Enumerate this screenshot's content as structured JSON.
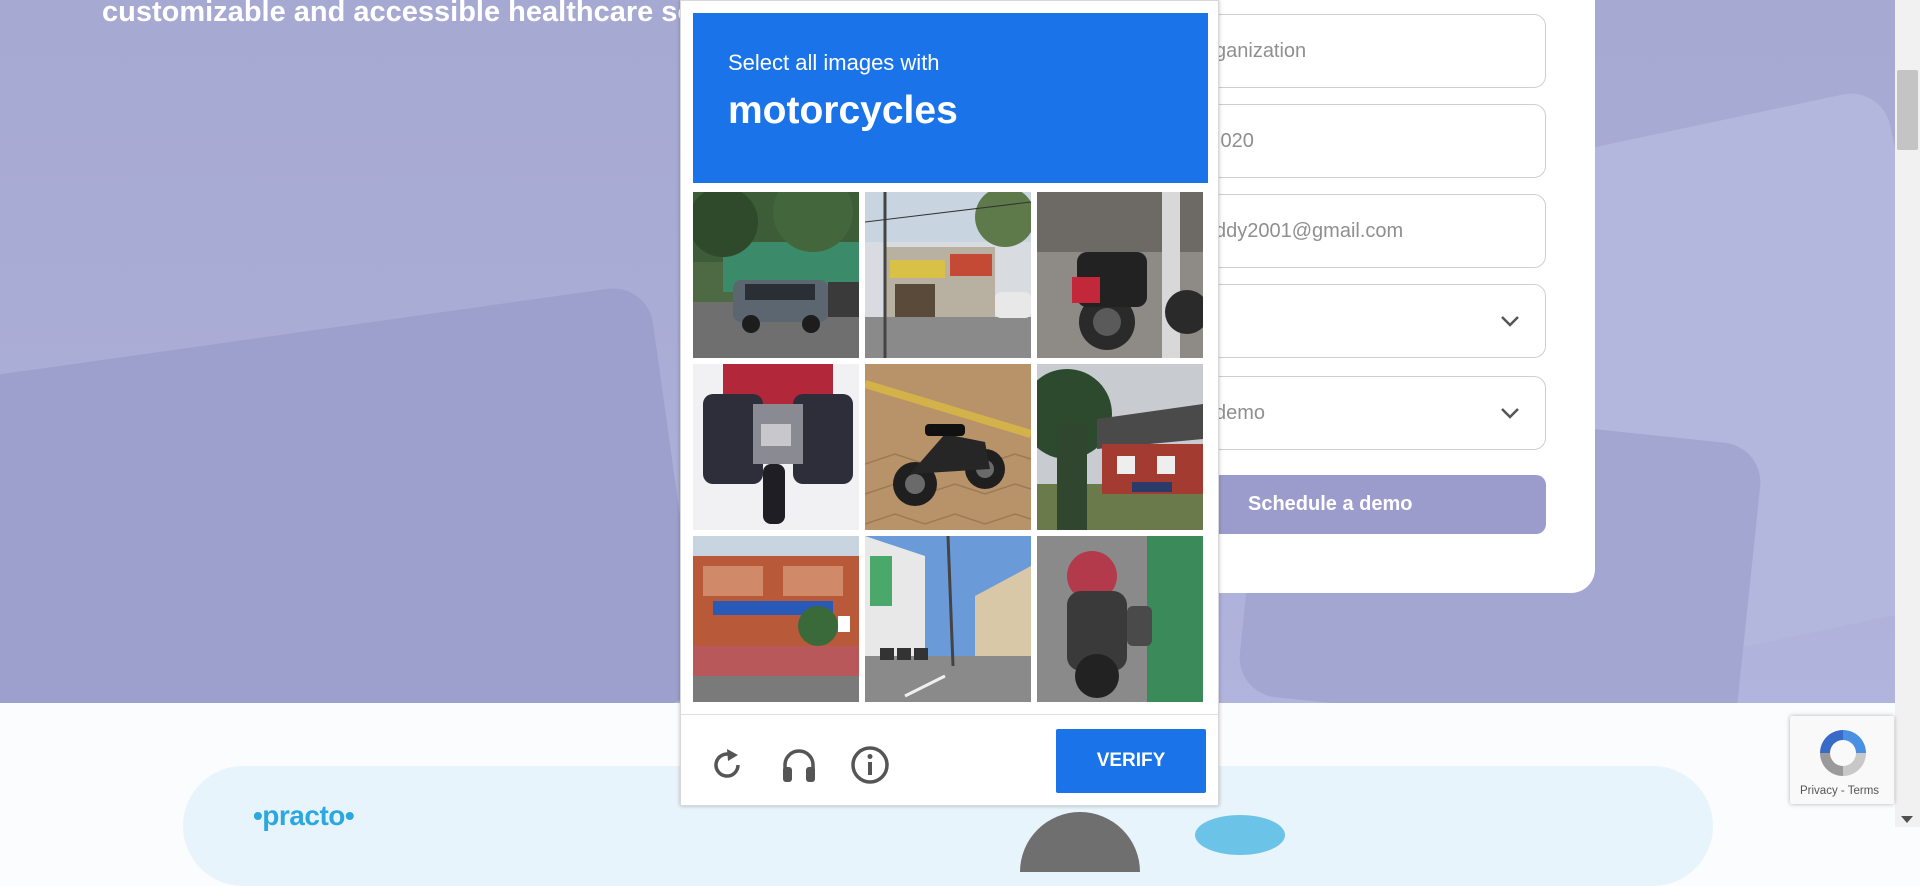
{
  "hero": {
    "text": "customizable and accessible healthcare solu"
  },
  "form": {
    "organization_value": "ganization",
    "phone_value": ".020",
    "email_value": "ddy2001@gmail.com",
    "select1_value": "",
    "select2_value": "demo",
    "schedule_label": "Schedule a demo"
  },
  "captcha": {
    "instruction_line1": "Select all images with",
    "instruction_target": "motorcycles",
    "accent_color": "#1a73e8",
    "tiles": [
      {
        "content": "car parked under trees"
      },
      {
        "content": "street storefront"
      },
      {
        "content": "motorcycle in garage"
      },
      {
        "content": "motorcycle rear close-up"
      },
      {
        "content": "motorcycle on paving"
      },
      {
        "content": "red house with tree"
      },
      {
        "content": "street with buildings"
      },
      {
        "content": "street with parked scooters"
      },
      {
        "content": "blurred scooter"
      }
    ],
    "reload_icon": "reload-icon",
    "audio_icon": "headphones-icon",
    "info_icon": "info-icon",
    "verify_label": "VERIFY"
  },
  "recaptcha_badge": {
    "text": "Privacy - Terms"
  },
  "partner": {
    "logo_text": "•practo•"
  }
}
